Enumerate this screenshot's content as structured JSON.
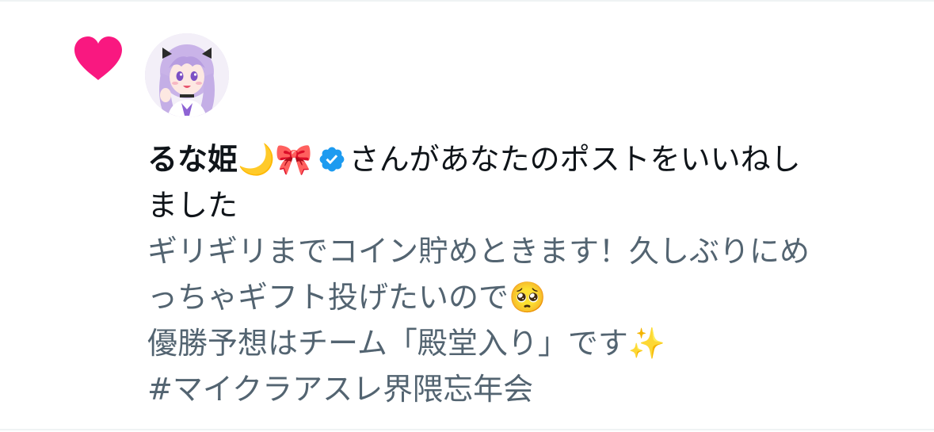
{
  "notification": {
    "user_name": "るな姫🌙🎀",
    "verified_icon": "verified-badge-icon",
    "action_line1": "さんがあなたのポストをいいねし",
    "action_line2": "ました"
  },
  "liked_post": {
    "line1": "ギリギリまでコイン貯めときます！久しぶりにめ",
    "line2": "っちゃギフト投げたいので🥺",
    "line3": "優勝予想はチーム「殿堂入り」です✨",
    "hashtag": " #マイクラアスレ界隈忘年会"
  },
  "icons": {
    "like": "heart-icon",
    "avatar": "user-avatar"
  },
  "colors": {
    "heart": "#f91880",
    "verified": "#1d9bf0",
    "primary_text": "#0f1419",
    "secondary_text": "#536471",
    "divider": "#eff3f4"
  }
}
